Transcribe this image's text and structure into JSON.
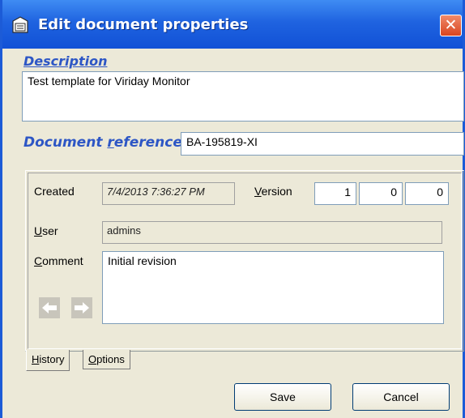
{
  "window": {
    "title": "Edit document properties",
    "close_symbol": "✕"
  },
  "description": {
    "label": "Description",
    "value": "Test template for Viriday Monitor"
  },
  "document_reference": {
    "label_pre": "Document ",
    "label_hotkey": "r",
    "label_post": "eference",
    "value": "BA-195819-XI"
  },
  "history": {
    "created_label": "Created",
    "created_value": "7/4/2013 7:36:27 PM",
    "version_label_hotkey": "V",
    "version_label_rest": "ersion",
    "version": [
      "1",
      "0",
      "0"
    ],
    "user_label_hotkey": "U",
    "user_label_rest": "ser",
    "user_value": "admins",
    "comment_label_hotkey": "C",
    "comment_label_rest": "omment",
    "comment_value": "Initial revision"
  },
  "tabs": [
    {
      "hotkey": "H",
      "rest": "istory"
    },
    {
      "hotkey": "O",
      "rest": "ptions"
    }
  ],
  "buttons": {
    "save": "Save",
    "cancel": "Cancel"
  }
}
